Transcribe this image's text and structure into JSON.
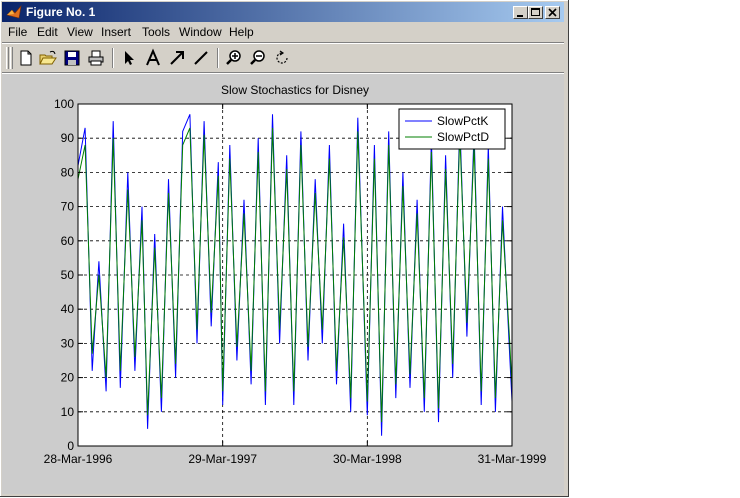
{
  "window": {
    "title": "Figure No. 1",
    "controls": [
      "minimize",
      "maximize",
      "close"
    ]
  },
  "menu": [
    "File",
    "Edit",
    "View",
    "Insert",
    "Tools",
    "Window",
    "Help"
  ],
  "toolbar": {
    "icons": [
      "new-figure-icon",
      "open-file-icon",
      "save-icon",
      "print-icon",
      "select-arrow-icon",
      "insert-text-icon",
      "insert-arrow-icon",
      "insert-line-icon",
      "zoom-in-icon",
      "zoom-out-icon",
      "rotate-3d-icon"
    ]
  },
  "chart_data": {
    "type": "line",
    "title": "Slow Stochastics for Disney",
    "xlabel": "",
    "ylabel": "",
    "x_tick_labels": [
      "28-Mar-1996",
      "29-Mar-1997",
      "30-Mar-1998",
      "31-Mar-1999"
    ],
    "x_range": [
      "1996-03-28",
      "1999-03-31"
    ],
    "ylim": [
      0,
      100
    ],
    "y_ticks": [
      0,
      10,
      20,
      30,
      40,
      50,
      60,
      70,
      80,
      90,
      100
    ],
    "grid": true,
    "legend_position": "top-right",
    "series": [
      {
        "name": "SlowPctK",
        "color": "#0000ff",
        "points": [
          [
            "1996-03-28",
            82
          ],
          [
            "1996-04-15",
            93
          ],
          [
            "1996-05-03",
            22
          ],
          [
            "1996-05-20",
            54
          ],
          [
            "1996-06-07",
            16
          ],
          [
            "1996-06-25",
            95
          ],
          [
            "1996-07-13",
            17
          ],
          [
            "1996-08-01",
            80
          ],
          [
            "1996-08-19",
            22
          ],
          [
            "1996-09-06",
            70
          ],
          [
            "1996-09-20",
            5
          ],
          [
            "1996-10-08",
            62
          ],
          [
            "1996-10-25",
            10
          ],
          [
            "1996-11-12",
            78
          ],
          [
            "1996-11-30",
            20
          ],
          [
            "1996-12-18",
            92
          ],
          [
            "1997-01-05",
            97
          ],
          [
            "1997-01-23",
            30
          ],
          [
            "1997-02-10",
            95
          ],
          [
            "1997-02-28",
            35
          ],
          [
            "1997-03-18",
            83
          ],
          [
            "1997-03-29",
            12
          ],
          [
            "1997-04-16",
            88
          ],
          [
            "1997-05-04",
            25
          ],
          [
            "1997-05-22",
            72
          ],
          [
            "1997-06-09",
            18
          ],
          [
            "1997-06-27",
            90
          ],
          [
            "1997-07-15",
            12
          ],
          [
            "1997-08-02",
            97
          ],
          [
            "1997-08-20",
            30
          ],
          [
            "1997-09-07",
            85
          ],
          [
            "1997-09-25",
            12
          ],
          [
            "1997-10-13",
            92
          ],
          [
            "1997-10-31",
            25
          ],
          [
            "1997-11-18",
            78
          ],
          [
            "1997-12-06",
            30
          ],
          [
            "1997-12-24",
            88
          ],
          [
            "1998-01-11",
            18
          ],
          [
            "1998-01-29",
            65
          ],
          [
            "1998-02-16",
            10
          ],
          [
            "1998-03-06",
            96
          ],
          [
            "1998-03-30",
            9
          ],
          [
            "1998-04-17",
            88
          ],
          [
            "1998-05-05",
            3
          ],
          [
            "1998-05-23",
            92
          ],
          [
            "1998-06-10",
            14
          ],
          [
            "1998-06-28",
            80
          ],
          [
            "1998-07-16",
            17
          ],
          [
            "1998-08-03",
            72
          ],
          [
            "1998-08-21",
            10
          ],
          [
            "1998-09-08",
            90
          ],
          [
            "1998-09-26",
            7
          ],
          [
            "1998-10-14",
            85
          ],
          [
            "1998-11-01",
            20
          ],
          [
            "1998-11-19",
            95
          ],
          [
            "1998-12-07",
            32
          ],
          [
            "1998-12-25",
            92
          ],
          [
            "1999-01-12",
            12
          ],
          [
            "1999-01-30",
            88
          ],
          [
            "1999-02-17",
            10
          ],
          [
            "1999-03-07",
            70
          ],
          [
            "1999-03-25",
            27
          ],
          [
            "1999-03-31",
            13
          ]
        ]
      },
      {
        "name": "SlowPctD",
        "color": "#007f00",
        "points": [
          [
            "1996-03-28",
            78
          ],
          [
            "1996-04-15",
            88
          ],
          [
            "1996-05-03",
            27
          ],
          [
            "1996-05-20",
            50
          ],
          [
            "1996-06-07",
            20
          ],
          [
            "1996-06-25",
            90
          ],
          [
            "1996-07-13",
            22
          ],
          [
            "1996-08-01",
            75
          ],
          [
            "1996-08-19",
            26
          ],
          [
            "1996-09-06",
            66
          ],
          [
            "1996-09-20",
            9
          ],
          [
            "1996-10-08",
            58
          ],
          [
            "1996-10-25",
            14
          ],
          [
            "1996-11-12",
            74
          ],
          [
            "1996-11-30",
            24
          ],
          [
            "1996-12-18",
            88
          ],
          [
            "1997-01-05",
            93
          ],
          [
            "1997-01-23",
            34
          ],
          [
            "1997-02-10",
            91
          ],
          [
            "1997-02-28",
            39
          ],
          [
            "1997-03-18",
            79
          ],
          [
            "1997-03-29",
            16
          ],
          [
            "1997-04-16",
            84
          ],
          [
            "1997-05-04",
            29
          ],
          [
            "1997-05-22",
            68
          ],
          [
            "1997-06-09",
            22
          ],
          [
            "1997-06-27",
            86
          ],
          [
            "1997-07-15",
            16
          ],
          [
            "1997-08-02",
            93
          ],
          [
            "1997-08-20",
            34
          ],
          [
            "1997-09-07",
            81
          ],
          [
            "1997-09-25",
            16
          ],
          [
            "1997-10-13",
            88
          ],
          [
            "1997-10-31",
            29
          ],
          [
            "1997-11-18",
            74
          ],
          [
            "1997-12-06",
            34
          ],
          [
            "1997-12-24",
            84
          ],
          [
            "1998-01-11",
            22
          ],
          [
            "1998-01-29",
            61
          ],
          [
            "1998-02-16",
            14
          ],
          [
            "1998-03-06",
            92
          ],
          [
            "1998-03-30",
            13
          ],
          [
            "1998-04-17",
            84
          ],
          [
            "1998-05-05",
            7
          ],
          [
            "1998-05-23",
            88
          ],
          [
            "1998-06-10",
            18
          ],
          [
            "1998-06-28",
            76
          ],
          [
            "1998-07-16",
            21
          ],
          [
            "1998-08-03",
            68
          ],
          [
            "1998-08-21",
            14
          ],
          [
            "1998-09-08",
            86
          ],
          [
            "1998-09-26",
            11
          ],
          [
            "1998-10-14",
            81
          ],
          [
            "1998-11-01",
            24
          ],
          [
            "1998-11-19",
            91
          ],
          [
            "1998-12-07",
            36
          ],
          [
            "1998-12-25",
            88
          ],
          [
            "1999-01-12",
            16
          ],
          [
            "1999-01-30",
            84
          ],
          [
            "1999-02-17",
            14
          ],
          [
            "1999-03-07",
            66
          ],
          [
            "1999-03-25",
            31
          ],
          [
            "1999-03-31",
            17
          ]
        ]
      }
    ]
  }
}
